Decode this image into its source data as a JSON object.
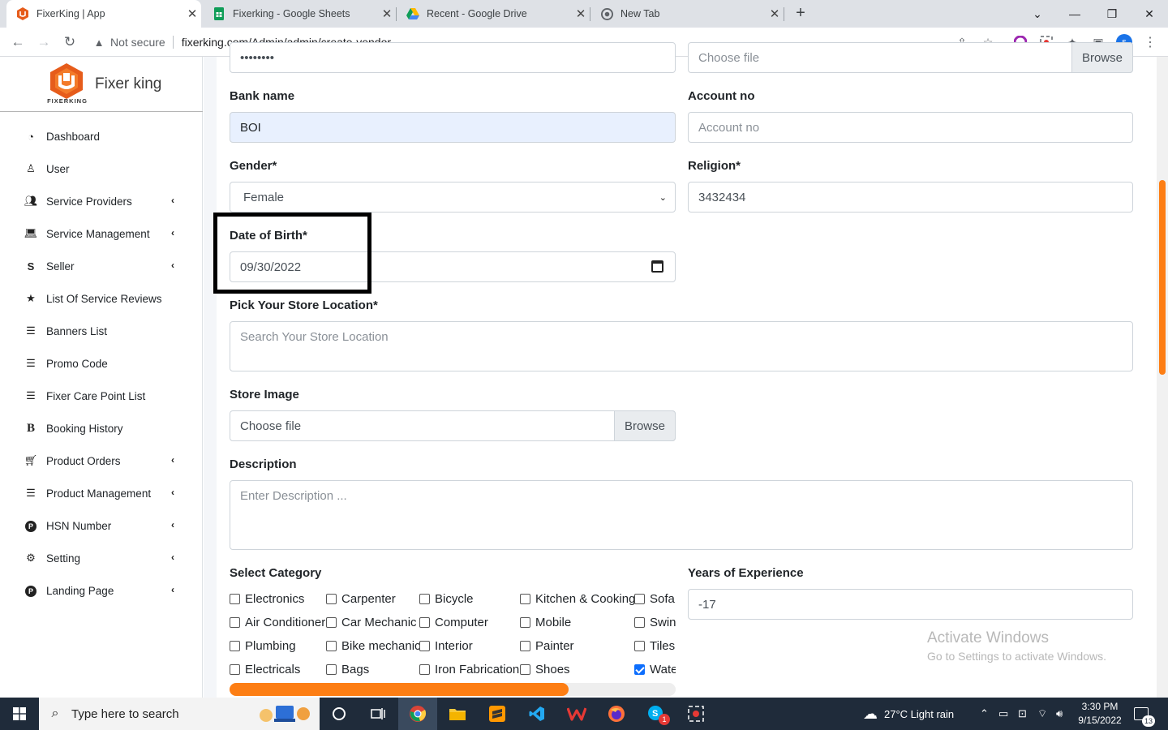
{
  "browser": {
    "tabs": [
      {
        "title": "FixerKing | App",
        "icon": "fixerking-favicon",
        "active": true
      },
      {
        "title": "Fixerking - Google Sheets",
        "icon": "sheets-icon",
        "active": false
      },
      {
        "title": "Recent - Google Drive",
        "icon": "drive-icon",
        "active": false
      },
      {
        "title": "New Tab",
        "icon": "chrome-icon",
        "active": false
      }
    ],
    "security_label": "Not secure",
    "url": "fixerking.com/Admin/admin/create-vendor",
    "profile_initial": "s"
  },
  "sidebar": {
    "brand_name": "Fixer king",
    "brand_sub": "FIXERKING",
    "items": [
      {
        "label": "Dashboard",
        "icon": "dashboard-icon",
        "submenu": false
      },
      {
        "label": "User",
        "icon": "user-icon",
        "submenu": false
      },
      {
        "label": "Service Providers",
        "icon": "users-icon",
        "submenu": true
      },
      {
        "label": "Service Management",
        "icon": "laptop-icon",
        "submenu": true
      },
      {
        "label": "Seller",
        "icon": "seller-icon",
        "submenu": true
      },
      {
        "label": "List Of Service Reviews",
        "icon": "star-icon",
        "submenu": false
      },
      {
        "label": "Banners List",
        "icon": "list-icon",
        "submenu": false
      },
      {
        "label": "Promo Code",
        "icon": "list-icon",
        "submenu": false
      },
      {
        "label": "Fixer Care Point List",
        "icon": "list-icon",
        "submenu": false
      },
      {
        "label": "Booking History",
        "icon": "bold-b-icon",
        "submenu": false
      },
      {
        "label": "Product Orders",
        "icon": "cart-icon",
        "submenu": true
      },
      {
        "label": "Product Management",
        "icon": "list-icon",
        "submenu": true
      },
      {
        "label": "HSN Number",
        "icon": "product-hunt-icon",
        "submenu": true
      },
      {
        "label": "Setting",
        "icon": "cogs-icon",
        "submenu": true
      },
      {
        "label": "Landing Page",
        "icon": "product-hunt-icon",
        "submenu": true
      }
    ]
  },
  "form": {
    "password_value": "••••••••",
    "top_file_placeholder": "Choose file",
    "browse_label": "Browse",
    "bank_name": {
      "label": "Bank name",
      "value": "BOI"
    },
    "account_no": {
      "label": "Account no",
      "placeholder": "Account no"
    },
    "gender": {
      "label": "Gender*",
      "value": "Female"
    },
    "religion": {
      "label": "Religion*",
      "value": "3432434"
    },
    "dob": {
      "label": "Date of Birth*",
      "value": "09/30/2022"
    },
    "store_location": {
      "label": "Pick Your Store Location*",
      "placeholder": "Search Your Store Location"
    },
    "store_image": {
      "label": "Store Image",
      "placeholder": "Choose file",
      "browse": "Browse"
    },
    "description": {
      "label": "Description",
      "placeholder": "Enter Description ..."
    },
    "category": {
      "label": "Select Category",
      "columns": [
        [
          {
            "name": "Electronics",
            "checked": false
          },
          {
            "name": "Air Conditioner",
            "checked": false
          },
          {
            "name": "Plumbing",
            "checked": false
          },
          {
            "name": "Electricals",
            "checked": false
          }
        ],
        [
          {
            "name": "Carpenter",
            "checked": false
          },
          {
            "name": "Car Mechanic",
            "checked": false
          },
          {
            "name": "Bike mechanic",
            "checked": false
          },
          {
            "name": "Bags",
            "checked": false
          }
        ],
        [
          {
            "name": "Bicycle",
            "checked": false
          },
          {
            "name": "Computer",
            "checked": false
          },
          {
            "name": "Interior",
            "checked": false
          },
          {
            "name": "Iron Fabrication",
            "checked": false
          }
        ],
        [
          {
            "name": "Kitchen & Cooking",
            "checked": false
          },
          {
            "name": "Mobile",
            "checked": false
          },
          {
            "name": "Painter",
            "checked": false
          },
          {
            "name": "Shoes",
            "checked": false
          }
        ],
        [
          {
            "name": "Sofa",
            "checked": false
          },
          {
            "name": "Swin",
            "checked": false
          },
          {
            "name": "Tiles",
            "checked": false
          },
          {
            "name": "Wate",
            "checked": true
          }
        ]
      ],
      "scroll_progress": 0.76
    },
    "experience": {
      "label": "Years of Experience",
      "value": "-17"
    }
  },
  "watermark": {
    "line1": "Activate Windows",
    "line2": "Go to Settings to activate Windows."
  },
  "taskbar": {
    "search_placeholder": "Type here to search",
    "weather": "27°C  Light rain",
    "time": "3:30 PM",
    "date": "9/15/2022",
    "notification_count": "13",
    "skype_badge": "1"
  },
  "colors": {
    "accent": "#fd7e14",
    "autofill": "#e8f0fe",
    "taskbar": "#1f2b3a"
  }
}
